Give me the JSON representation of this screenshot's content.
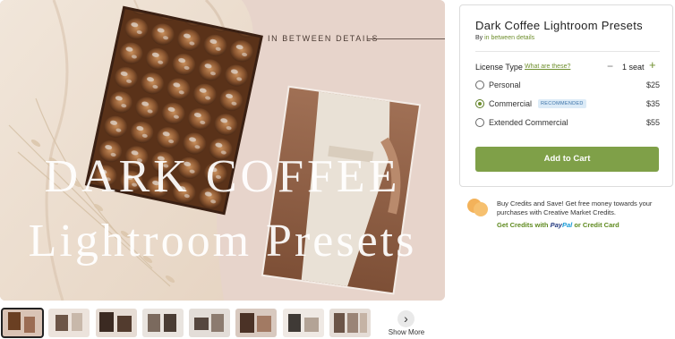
{
  "hero": {
    "brand_tag": "IN BETWEEN DETAILS",
    "title_line1": "DARK COFFEE",
    "title_line2": "Lightroom Presets"
  },
  "thumbnails": {
    "count": 8,
    "active_index": 0,
    "show_more_icon": "chevron-right-icon",
    "show_more_label": "Show More"
  },
  "product": {
    "title": "Dark Coffee Lightroom Presets",
    "by_prefix": "By",
    "shop_name": "in between details",
    "license_label": "License Type",
    "license_help": "What are these?",
    "seat_minus": "−",
    "seat_text": "1 seat",
    "seat_plus": "+",
    "options": [
      {
        "name": "Personal",
        "price": "$25",
        "selected": false
      },
      {
        "name": "Commercial",
        "price": "$35",
        "selected": true,
        "badge": "RECOMMENDED"
      },
      {
        "name": "Extended Commercial",
        "price": "$55",
        "selected": false
      }
    ],
    "cart_button": "Add to Cart"
  },
  "promo": {
    "text": "Buy Credits and Save! Get free money towards your purchases with Creative Market Credits.",
    "link_prefix": "Get Credits with",
    "paypal_a": "Pay",
    "paypal_b": "Pal",
    "link_suffix": "or Credit Card"
  },
  "colors": {
    "accent_green": "#7fa048",
    "link_green": "#6f8f2e",
    "badge_blue": "#dcebf7",
    "coin_orange": "#f3b25a"
  }
}
